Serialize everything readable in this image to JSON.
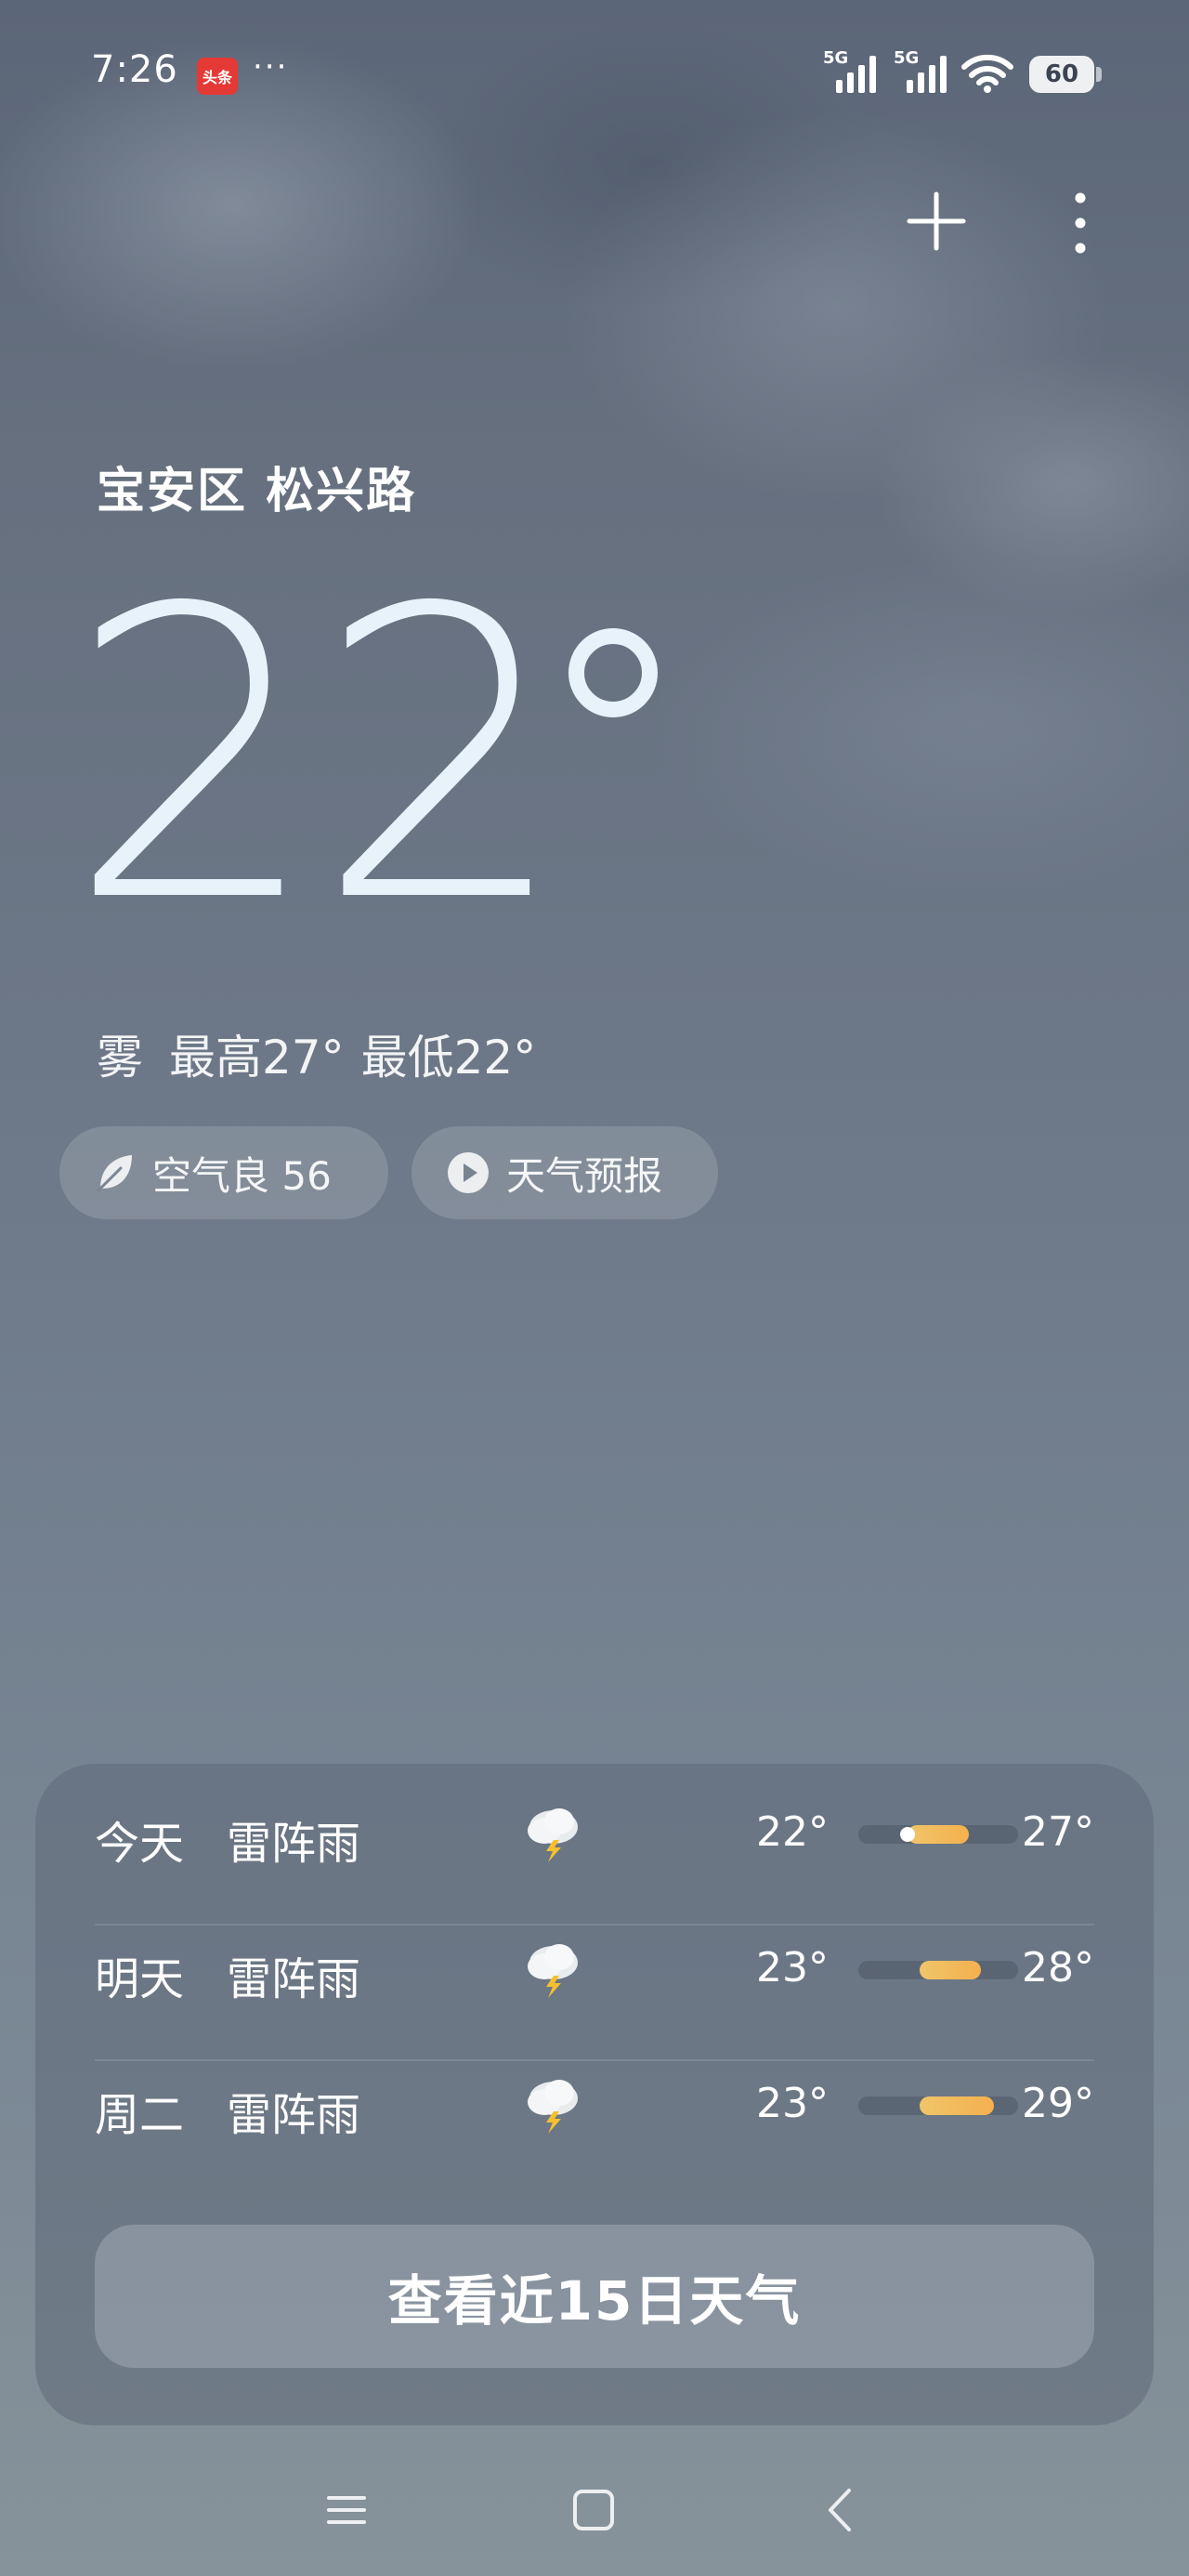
{
  "status_bar": {
    "time": "7:26",
    "app_badge": "头条",
    "more": "···",
    "sim1_label": "5G",
    "sim2_label": "5G",
    "battery": "60",
    "icons": [
      "signal-icon",
      "wifi-icon",
      "battery-icon"
    ]
  },
  "header": {
    "actions": [
      "plus-icon",
      "more-vertical-icon"
    ]
  },
  "current": {
    "location": "宝安区 松兴路",
    "temperature": "22",
    "condition": "雾",
    "high": "最高27°",
    "low": "最低22°"
  },
  "chips": {
    "air_quality": "空气良 56",
    "forecast_video": "天气预报"
  },
  "forecast": {
    "days": [
      {
        "day": "今天",
        "condition": "雷阵雨",
        "icon": "thunderstorm-icon",
        "low": "22°",
        "high": "27°",
        "low_value": 22,
        "high_value": 27,
        "current_value": 22
      },
      {
        "day": "明天",
        "condition": "雷阵雨",
        "icon": "thunderstorm-icon",
        "low": "23°",
        "high": "28°",
        "low_value": 23,
        "high_value": 28
      },
      {
        "day": "周二",
        "condition": "雷阵雨",
        "icon": "thunderstorm-icon",
        "low": "23°",
        "high": "29°",
        "low_value": 23,
        "high_value": 29
      }
    ],
    "range_min": 18,
    "range_max": 31,
    "cta": "查看近15日天气"
  },
  "nav": [
    "menu-icon",
    "home-icon",
    "back-icon"
  ],
  "colors": {
    "accent_bar": "#f4b04e",
    "card_bg": "#5f6978"
  }
}
